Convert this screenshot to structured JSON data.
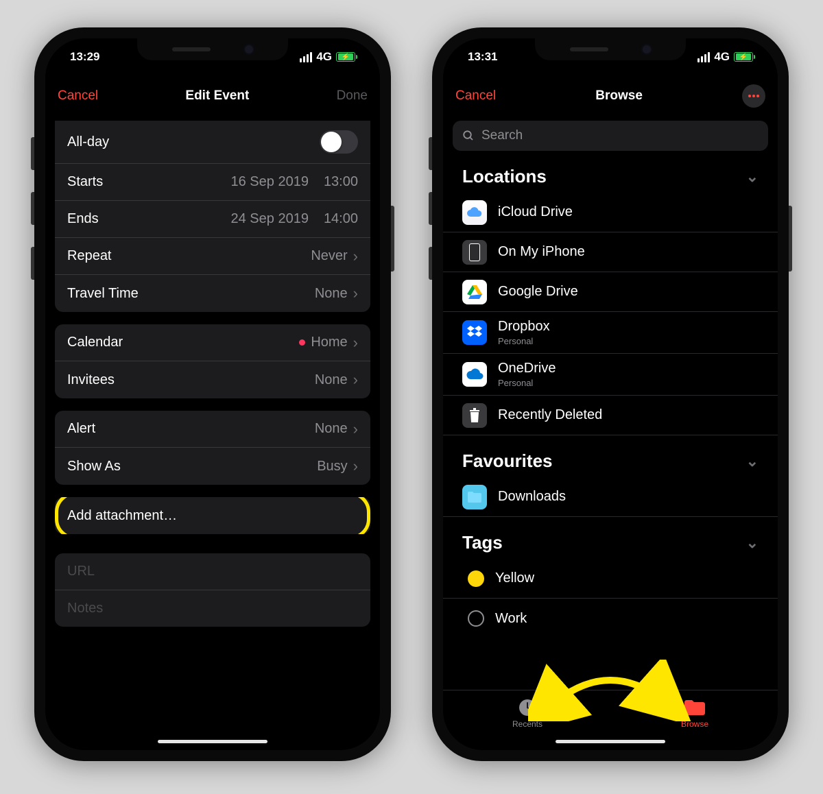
{
  "left": {
    "status": {
      "time": "13:29",
      "network": "4G"
    },
    "nav": {
      "cancel": "Cancel",
      "title": "Edit Event",
      "done": "Done"
    },
    "rows": {
      "allday": "All-day",
      "starts_label": "Starts",
      "starts_date": "16 Sep 2019",
      "starts_time": "13:00",
      "ends_label": "Ends",
      "ends_date": "24 Sep 2019",
      "ends_time": "14:00",
      "repeat_label": "Repeat",
      "repeat_value": "Never",
      "travel_label": "Travel Time",
      "travel_value": "None",
      "calendar_label": "Calendar",
      "calendar_value": "Home",
      "invitees_label": "Invitees",
      "invitees_value": "None",
      "alert_label": "Alert",
      "alert_value": "None",
      "showas_label": "Show As",
      "showas_value": "Busy",
      "attachment_label": "Add attachment…",
      "url_placeholder": "URL",
      "notes_placeholder": "Notes"
    }
  },
  "right": {
    "status": {
      "time": "13:31",
      "network": "4G"
    },
    "nav": {
      "cancel": "Cancel",
      "title": "Browse"
    },
    "search_placeholder": "Search",
    "sections": {
      "locations_title": "Locations",
      "favourites_title": "Favourites",
      "tags_title": "Tags"
    },
    "locations": {
      "icloud": "iCloud Drive",
      "onmy": "On My iPhone",
      "gdrive": "Google Drive",
      "dropbox": "Dropbox",
      "dropbox_sub": "Personal",
      "onedrive": "OneDrive",
      "onedrive_sub": "Personal",
      "trash": "Recently Deleted"
    },
    "favourites": {
      "downloads": "Downloads"
    },
    "tags": {
      "yellow": "Yellow",
      "work": "Work"
    },
    "tabs": {
      "recents": "Recents",
      "browse": "Browse"
    }
  }
}
